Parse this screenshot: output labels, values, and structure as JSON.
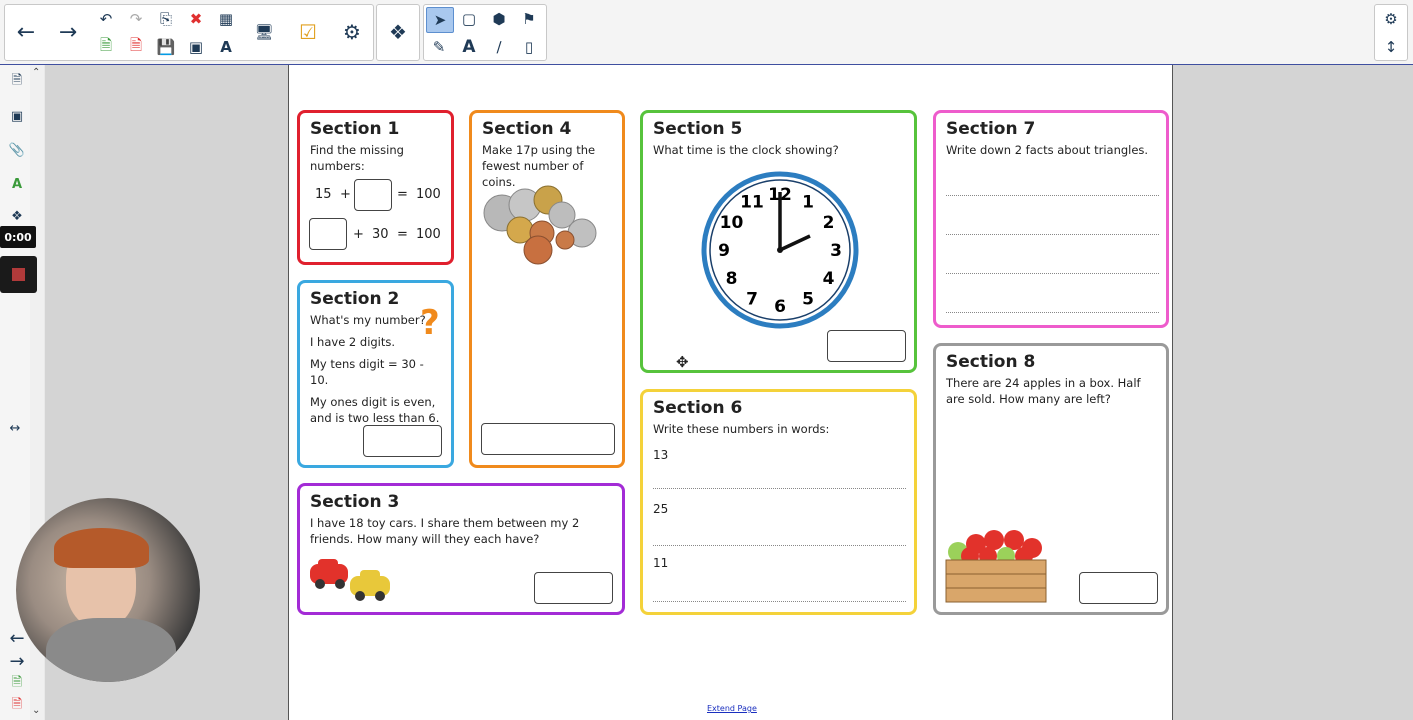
{
  "toolbar": {
    "buttons": [
      "back-arrow-icon",
      "forward-arrow-icon",
      "undo-icon",
      "redo-icon",
      "paste-icon",
      "delete-icon",
      "table-icon",
      "monitor-icon",
      "check-icon",
      "puzzle-icon",
      "puzzle-piece-icon",
      "select-pointer-icon",
      "shape-icon",
      "fill-icon",
      "paint-icon",
      "pen-icon",
      "text-icon",
      "line-icon",
      "eraser-icon",
      "settings-icon",
      "expand-icon"
    ]
  },
  "recorder": {
    "time": "0:00"
  },
  "sections": {
    "s1": {
      "title": "Section 1",
      "text": "Find the missing numbers:",
      "eq1a": "15",
      "plus": "+",
      "eq1b": "=",
      "eq1c": "100",
      "eq2a": "+",
      "eq2b": "30",
      "eq2c": "=",
      "eq2d": "100"
    },
    "s2": {
      "title": "Section 2",
      "q": "What's my number?",
      "qmark": "?",
      "l1": "I have 2 digits.",
      "l2": "My tens digit = 30 - 10.",
      "l3": "My ones digit is even, and is two less than 6."
    },
    "s3": {
      "title": "Section 3",
      "text": "I have 18 toy cars. I share them between my 2 friends. How many will they each have?"
    },
    "s4": {
      "title": "Section 4",
      "text": "Make 17p using the fewest number of coins."
    },
    "s5": {
      "title": "Section 5",
      "text": "What time is the clock showing?",
      "numbers": [
        "12",
        "1",
        "2",
        "3",
        "4",
        "5",
        "6",
        "7",
        "8",
        "9",
        "10",
        "11"
      ]
    },
    "s6": {
      "title": "Section 6",
      "text": "Write these numbers in words:",
      "n1": "13",
      "n2": "25",
      "n3": "11"
    },
    "s7": {
      "title": "Section 7",
      "text": "Write down 2 facts about triangles."
    },
    "s8": {
      "title": "Section 8",
      "text": "There are 24 apples in a box. Half are sold. How many are left?"
    }
  },
  "footer": {
    "extend": "Extend Page"
  },
  "colors": {
    "s1": "#e0202e",
    "s2": "#3aa8e0",
    "s3": "#a32bd6",
    "s4": "#f08a1c",
    "s5": "#57c33c",
    "s6": "#f4d23a",
    "s7": "#ee5ccc",
    "s8": "#9a9a9a"
  }
}
